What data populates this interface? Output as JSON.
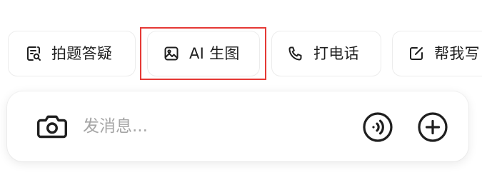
{
  "chips": [
    {
      "label": "拍题答疑",
      "icon": "search-document-icon"
    },
    {
      "label": "AI 生图",
      "icon": "image-icon"
    },
    {
      "label": "打电话",
      "icon": "phone-icon"
    },
    {
      "label": "帮我写",
      "icon": "edit-icon"
    }
  ],
  "highlighted_chip": "AI 生图",
  "input": {
    "placeholder": "发消息..."
  },
  "icons": {
    "camera": "camera-icon",
    "voice": "voice-call-icon",
    "add": "plus-circle-icon"
  },
  "colors": {
    "highlight": "#e53935",
    "text": "#1f1f1f",
    "placeholder": "#a6a6a6",
    "chip_border": "#ececec"
  }
}
